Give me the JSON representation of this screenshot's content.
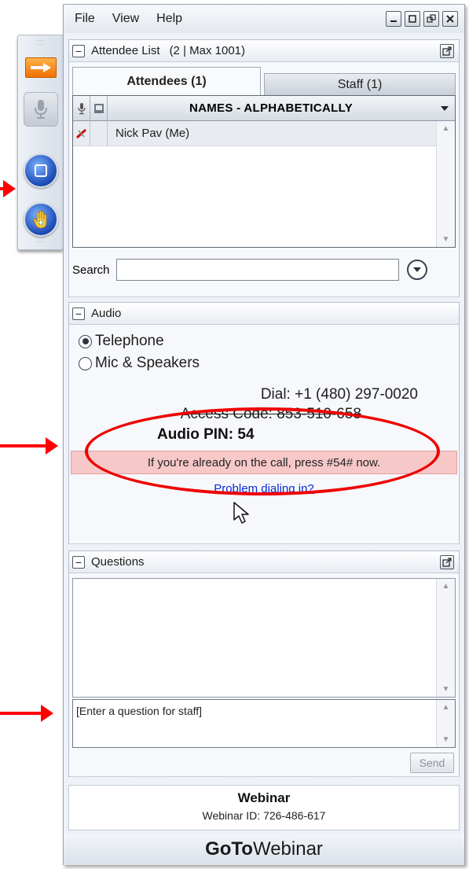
{
  "menu": {
    "file": "File",
    "view": "View",
    "help": "Help"
  },
  "window_controls": [
    "minimize-icon",
    "maximize-icon",
    "restore-icon",
    "close-icon"
  ],
  "attendee_list": {
    "title": "Attendee List",
    "count": "(2 | Max 1001)",
    "tabs": {
      "attendees": "Attendees (1)",
      "staff": "Staff (1)"
    },
    "column_header": "NAMES - ALPHABETICALLY",
    "rows": [
      {
        "name": "Nick Pav (Me)"
      }
    ],
    "search_label": "Search",
    "search_value": ""
  },
  "audio": {
    "title": "Audio",
    "options": {
      "telephone": "Telephone",
      "mic": "Mic & Speakers"
    },
    "selected": "telephone",
    "dial": "Dial: +1 (480) 297-0020",
    "access_code": "Access Code: 853-510-658",
    "pin": "Audio PIN: 54",
    "pin_note": "If you're already on the call, press #54# now.",
    "problem_link": "Problem dialing in?"
  },
  "questions": {
    "title": "Questions",
    "input_text": "[Enter a question for staff]",
    "send": "Send"
  },
  "footer": {
    "title": "Webinar",
    "webinar_id": "Webinar ID: 726-486-617",
    "brand_bold": "GoTo",
    "brand_regular": "Webinar"
  },
  "colors": {
    "annotation_red": "#ff0000",
    "pin_note_bg": "#f7c8c8",
    "link_blue": "#0a2bd6",
    "toolbar_orange": "#f07000",
    "toolbar_blue": "#1f4fb8"
  },
  "icons": {
    "toolbar": [
      "arrow-right-icon",
      "microphone-icon",
      "screen-share-icon",
      "raise-hand-icon"
    ]
  }
}
